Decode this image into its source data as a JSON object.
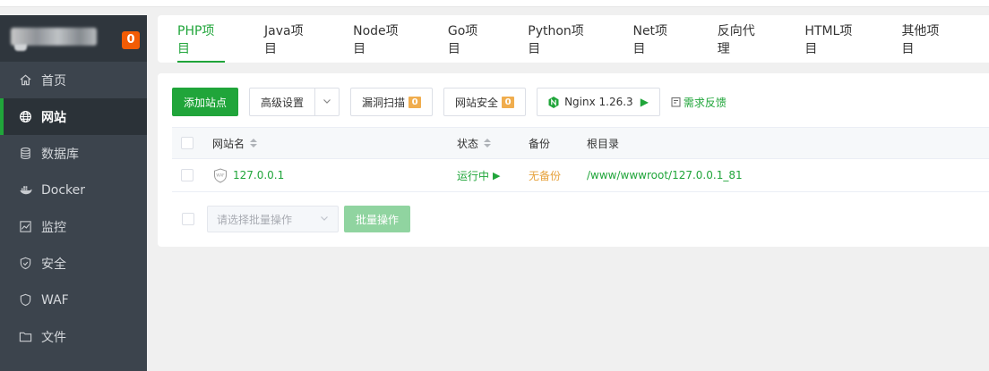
{
  "sidebar": {
    "notify_count": "0",
    "items": [
      {
        "label": "首页",
        "icon": "home-icon"
      },
      {
        "label": "网站",
        "icon": "globe-icon",
        "active": true
      },
      {
        "label": "数据库",
        "icon": "database-icon"
      },
      {
        "label": "Docker",
        "icon": "docker-icon"
      },
      {
        "label": "监控",
        "icon": "monitor-icon"
      },
      {
        "label": "安全",
        "icon": "shield-icon"
      },
      {
        "label": "WAF",
        "icon": "waf-icon"
      },
      {
        "label": "文件",
        "icon": "folder-icon"
      }
    ]
  },
  "tabs": [
    "PHP项目",
    "Java项目",
    "Node项目",
    "Go项目",
    "Python项目",
    "Net项目",
    "反向代理",
    "HTML项目",
    "其他项目"
  ],
  "active_tab": 0,
  "toolbar": {
    "add_site": "添加站点",
    "advanced": "高级设置",
    "vuln_scan": "漏洞扫描",
    "vuln_scan_count": "0",
    "site_security": "网站安全",
    "site_security_count": "0",
    "nginx": "Nginx 1.26.3",
    "feedback": "需求反馈"
  },
  "table": {
    "headers": {
      "name": "网站名",
      "status": "状态",
      "backup": "备份",
      "root": "根目录"
    },
    "rows": [
      {
        "name": "127.0.0.1",
        "status": "运行中",
        "backup": "无备份",
        "root": "/www/wwwroot/127.0.0.1_81"
      }
    ]
  },
  "batch": {
    "placeholder": "请选择批量操作",
    "button": "批量操作"
  },
  "colors": {
    "accent": "#20a53a",
    "sidebar_bg": "#3c444d",
    "badge": "#f25c05",
    "warning": "#e6a23c"
  }
}
